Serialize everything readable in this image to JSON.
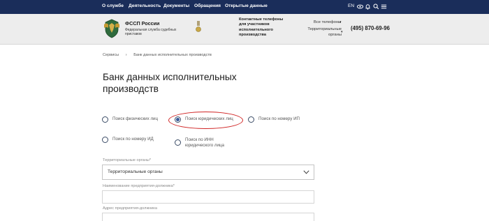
{
  "nav": {
    "items": [
      "О службе",
      "Деятельность",
      "Документы",
      "Обращения",
      "Открытые данные"
    ],
    "lang": "EN"
  },
  "header": {
    "org_name": "ФССП России",
    "org_subtitle": "Федеральная служба судебных приставов",
    "contact_title": "Контактные телефоны для участников исполнительного производства",
    "all_phones": "Все телефоны",
    "territorial": "Территориальные органы",
    "phone": "(495) 870-69-96"
  },
  "breadcrumb": [
    "Сервисы",
    "›",
    "Банк данных исполнительных производств"
  ],
  "page_title": "Банк данных исполнительных производств",
  "search_modes": [
    {
      "label": "Поиск физических лиц",
      "selected": false
    },
    {
      "label": "Поиск юридических лиц",
      "selected": true
    },
    {
      "label": "Поиск по номеру ИП",
      "selected": false
    },
    {
      "label": "Поиск по номеру ИД",
      "selected": false
    },
    {
      "label": "Поиск по ИНН юридического лица",
      "selected": false
    }
  ],
  "form": {
    "territorial_label": "Территориальные органы*",
    "territorial_value": "Территориальные органы",
    "company_label": "Наименование предприятия-должника*",
    "address_label": "Адрес предприятия-должника"
  },
  "colors": {
    "nav_bg": "#1a2d5a",
    "header_bg": "#ededed",
    "highlight": "#d02424"
  }
}
